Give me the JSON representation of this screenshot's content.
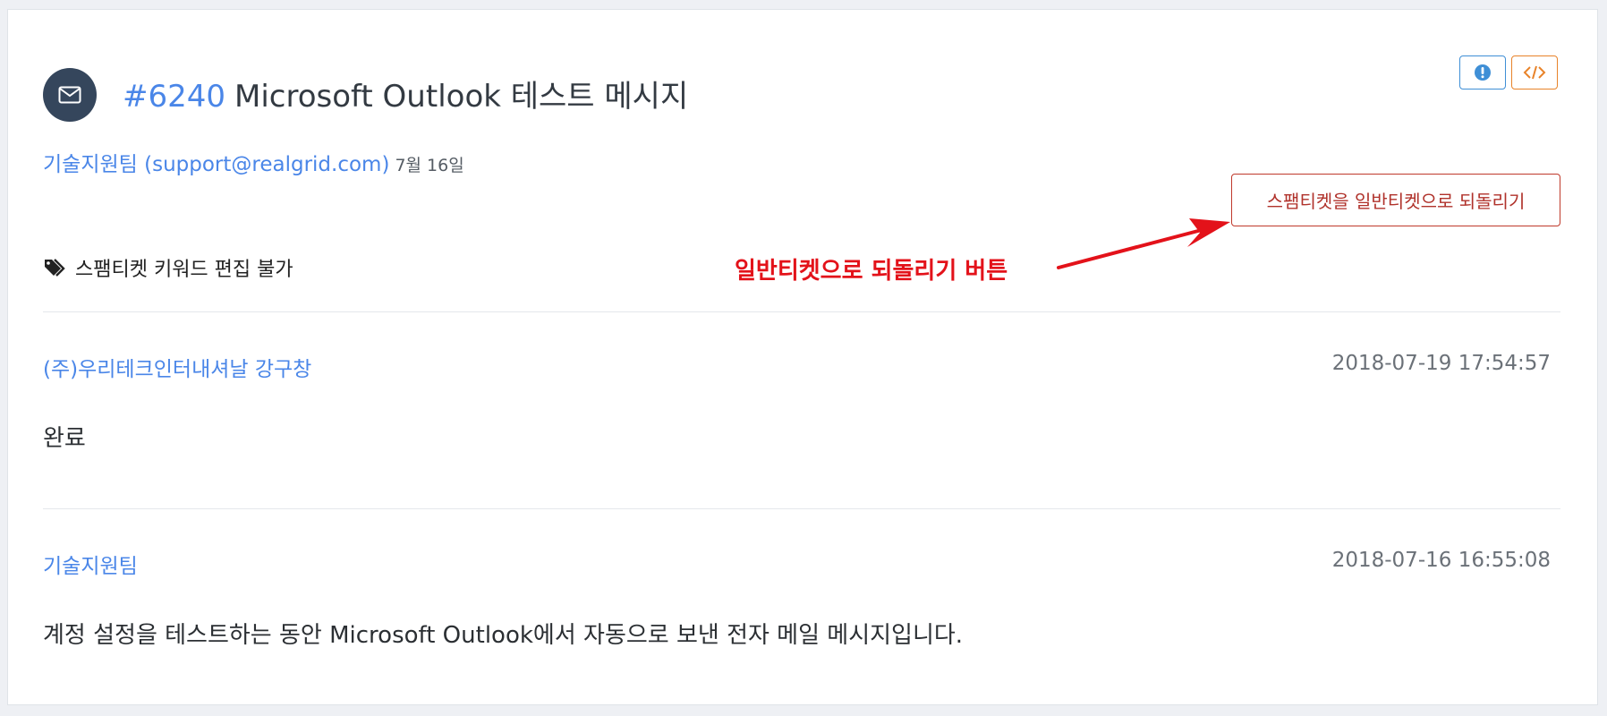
{
  "ticket": {
    "number": "#6240",
    "title": "Microsoft Outlook 테스트 메시지",
    "sender": "기술지원팀 (support@realgrid.com)",
    "date": "7월 16일",
    "tag_text": "스팸티켓 키워드 편집 불가",
    "revert_button_label": "스팸티켓을 일반티켓으로 되돌리기",
    "annotation_label": "일반티켓으로 되돌리기 버튼"
  },
  "icons": {
    "avatar": "envelope-icon",
    "info": "exclamation-circle-icon",
    "code": "code-icon",
    "tag": "tags-icon"
  },
  "messages": [
    {
      "author": "(주)우리테크인터내셔날 강구창",
      "timestamp": "2018-07-19 17:54:57",
      "body": "완료"
    },
    {
      "author": "기술지원팀",
      "timestamp": "2018-07-16 16:55:08",
      "body": "계정 설정을 테스트하는 동안 Microsoft Outlook에서 자동으로 보낸 전자 메일 메시지입니다."
    }
  ],
  "colors": {
    "link_blue": "#4a86e8",
    "avatar_bg": "#35465c",
    "danger": "#c0392b",
    "annotation_red": "#e3121a",
    "info_blue": "#3f8fd6",
    "code_orange": "#e8832a"
  }
}
